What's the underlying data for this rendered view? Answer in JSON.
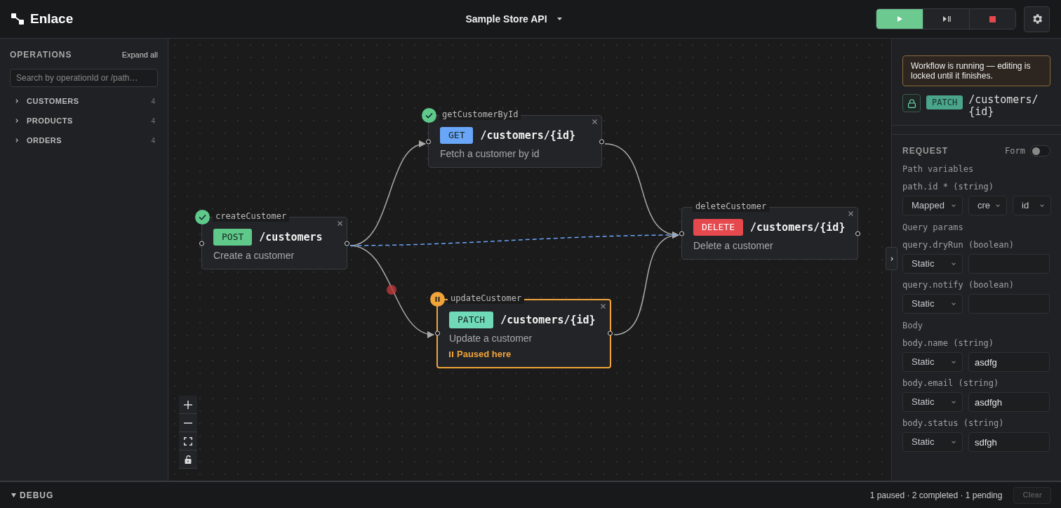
{
  "app": {
    "name": "Enlace"
  },
  "project": {
    "title": "Sample Store API"
  },
  "run_controls": [
    {
      "kind": "play",
      "selected": true
    },
    {
      "kind": "step",
      "selected": false
    },
    {
      "kind": "stop",
      "selected": false
    }
  ],
  "sidebar": {
    "title": "OPERATIONS",
    "expand_all": "Expand all",
    "search": {
      "placeholder": "Search by operationId or /path…"
    },
    "groups": [
      {
        "label": "CUSTOMERS",
        "count": "4",
        "expanded": false
      },
      {
        "label": "PRODUCTS",
        "count": "4",
        "expanded": false
      },
      {
        "label": "ORDERS",
        "count": "4",
        "expanded": false
      }
    ]
  },
  "canvas": {
    "nodes": [
      {
        "operation_id": "getCustomerById",
        "method": "GET",
        "color": "#6aa6f8",
        "path": "/customers/{id}",
        "description": "Fetch a customer by id",
        "completed": true,
        "paused": false
      },
      {
        "operation_id": "createCustomer",
        "method": "POST",
        "color": "#5fc98a",
        "path": "/customers",
        "description": "Create a customer",
        "completed": true,
        "paused": false
      },
      {
        "operation_id": "deleteCustomer",
        "method": "DELETE",
        "color": "#e5484d",
        "path": "/customers/{id}",
        "description": "Delete a customer",
        "completed": false,
        "paused": false
      },
      {
        "operation_id": "updateCustomer",
        "method": "PATCH",
        "color": "#6fd9b8",
        "path": "/customers/{id}",
        "description": "Update a customer",
        "completed": false,
        "paused": true,
        "status_label": "Paused here"
      }
    ]
  },
  "panel": {
    "notice": "Workflow is running — editing is locked until it finishes.",
    "locked": true,
    "method": "PATCH",
    "path": "/customers/{id}",
    "request": {
      "title": "REQUEST",
      "form_label": "Form",
      "form_on": false,
      "sections": [
        {
          "title": "Path variables",
          "params": [
            {
              "label": "path.id * (string)",
              "kind": "mapped",
              "source": "Mapped",
              "selects": [
                "cre",
                "id"
              ]
            }
          ]
        },
        {
          "title": "Query params",
          "params": [
            {
              "label": "query.dryRun (boolean)",
              "kind": "static",
              "source": "Static"
            },
            {
              "label": "query.notify (boolean)",
              "kind": "static",
              "source": "Static"
            }
          ]
        },
        {
          "title": "Body",
          "params": [
            {
              "label": "body.name (string)",
              "kind": "static",
              "source": "Static",
              "value": "asdfg"
            },
            {
              "label": "body.email (string)",
              "kind": "static",
              "source": "Static",
              "value": "asdfgh"
            },
            {
              "label": "body.status (string)",
              "kind": "static",
              "source": "Static",
              "value": "sdfgh"
            }
          ]
        }
      ]
    }
  },
  "debug": {
    "title": "DEBUG",
    "expanded": true,
    "summary": "1 paused · 2 completed · 1 pending",
    "clear": {
      "label": "Clear",
      "disabled": true
    }
  }
}
